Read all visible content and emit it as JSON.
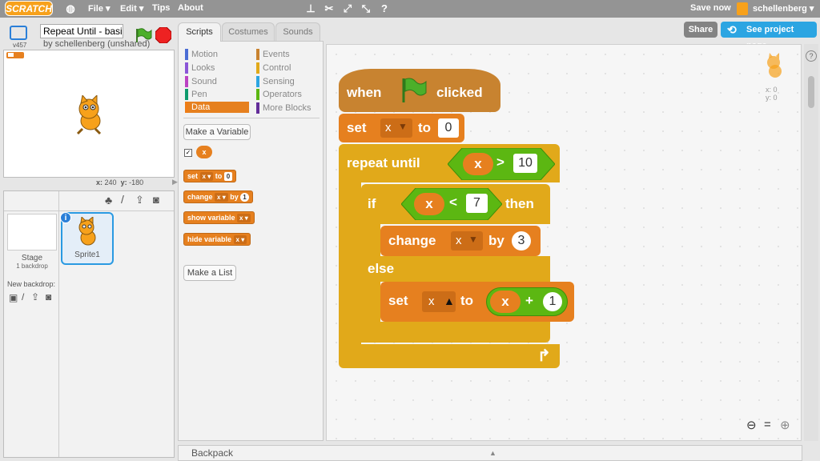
{
  "menu": {
    "logo": "SCRATCH",
    "file": "File ▾",
    "edit": "Edit ▾",
    "tips": "Tips",
    "about": "About",
    "save_now": "Save now",
    "username": "schellenberg ▾"
  },
  "project": {
    "title": "Repeat Until - basic",
    "byline": "by schellenberg (unshared)",
    "version": "v457",
    "share_label": "Share",
    "see_page_label": "See project page"
  },
  "stage": {
    "x_label": "x:",
    "x_value": "240",
    "y_label": "y:",
    "y_value": "-180"
  },
  "sprites": {
    "stage_label": "Stage",
    "stage_backdrops": "1 backdrop",
    "new_backdrop": "New backdrop:",
    "sprite_name": "Sprite1"
  },
  "tabs": {
    "scripts": "Scripts",
    "costumes": "Costumes",
    "sounds": "Sounds"
  },
  "categories": [
    {
      "label": "Motion",
      "color": "#4a6cd4"
    },
    {
      "label": "Events",
      "color": "#c88330"
    },
    {
      "label": "Looks",
      "color": "#8a55d7"
    },
    {
      "label": "Control",
      "color": "#e1a91a"
    },
    {
      "label": "Sound",
      "color": "#bb42c3"
    },
    {
      "label": "Sensing",
      "color": "#2ca5e2"
    },
    {
      "label": "Pen",
      "color": "#0e9a6c"
    },
    {
      "label": "Operators",
      "color": "#5cb712"
    },
    {
      "label": "Data",
      "color": "#ee7d16"
    },
    {
      "label": "More Blocks",
      "color": "#632d99"
    }
  ],
  "palette": {
    "make_variable": "Make a Variable",
    "var_name": "x",
    "set_block": {
      "a": "set",
      "var": "x ▾",
      "b": "to",
      "val": "0"
    },
    "change_block": {
      "a": "change",
      "var": "x ▾",
      "b": "by",
      "val": "1"
    },
    "show_block": {
      "a": "show variable",
      "var": "x ▾"
    },
    "hide_block": {
      "a": "hide variable",
      "var": "x ▾"
    },
    "make_list": "Make a List"
  },
  "script": {
    "hat_when": "when",
    "hat_clicked": "clicked",
    "set1": {
      "label": "set",
      "var": "x",
      "to": "to",
      "value": "0"
    },
    "repeat_label": "repeat until",
    "repeat_cond": {
      "var": "x",
      "op": ">",
      "value": "10"
    },
    "if_label": "if",
    "if_cond": {
      "var": "x",
      "op": "<",
      "value": "7"
    },
    "then_label": "then",
    "change": {
      "label": "change",
      "var": "x",
      "by": "by",
      "value": "3"
    },
    "else_label": "else",
    "set2": {
      "label": "set",
      "var": "x",
      "to": "to",
      "op_var": "x",
      "op": "+",
      "op_value": "1"
    }
  },
  "sprite_info": {
    "x_label": "x:",
    "x_value": "0",
    "y_label": "y:",
    "y_value": "0"
  },
  "backpack_label": "Backpack",
  "colors": {
    "data": "#e6801f",
    "control": "#e1a91a",
    "events": "#c88330",
    "operators": "#5cb712",
    "accent": "#2ca5e2"
  }
}
